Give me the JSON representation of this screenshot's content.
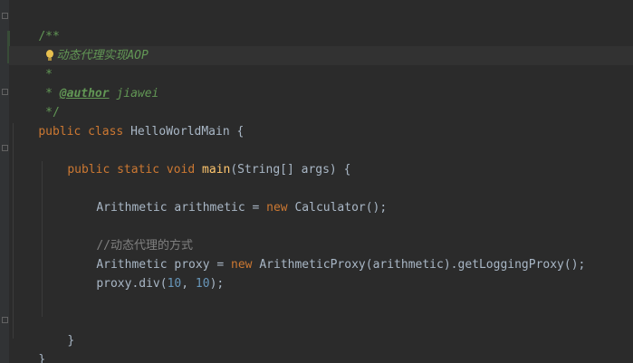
{
  "code": {
    "lines": {
      "l1": "/**",
      "l2_doc": "动态代理实现AOP",
      "l3": " *",
      "l4_prefix": " * ",
      "l4_tag": "@author",
      "l4_name": " jiawei",
      "l5": " */",
      "l6_kw1": "public",
      "l6_kw2": " class",
      "l6_rest": " HelloWorldMain {",
      "l8_kw1": "public",
      "l8_kw2": " static",
      "l8_kw3": " void",
      "l8_fn": " main",
      "l8_rest": "(String[] args) {",
      "l10_a": "Arithmetic arithmetic = ",
      "l10_kw": "new",
      "l10_b": " Calculator();",
      "l12_cmt": "//动态代理的方式",
      "l13_a": "Arithmetic proxy = ",
      "l13_kw": "new",
      "l13_b": " ArithmeticProxy(arithmetic).getLoggingProxy();",
      "l14_a": "proxy.div(",
      "l14_n1": "10",
      "l14_c": ", ",
      "l14_n2": "10",
      "l14_d": ");",
      "l17": "}",
      "l18": "}"
    }
  },
  "colors": {
    "background": "#2b2b2b",
    "keyword": "#cc7832",
    "function": "#ffc66d",
    "number": "#6897bb",
    "comment": "#808080",
    "javadoc": "#629755",
    "text": "#a9b7c6"
  }
}
